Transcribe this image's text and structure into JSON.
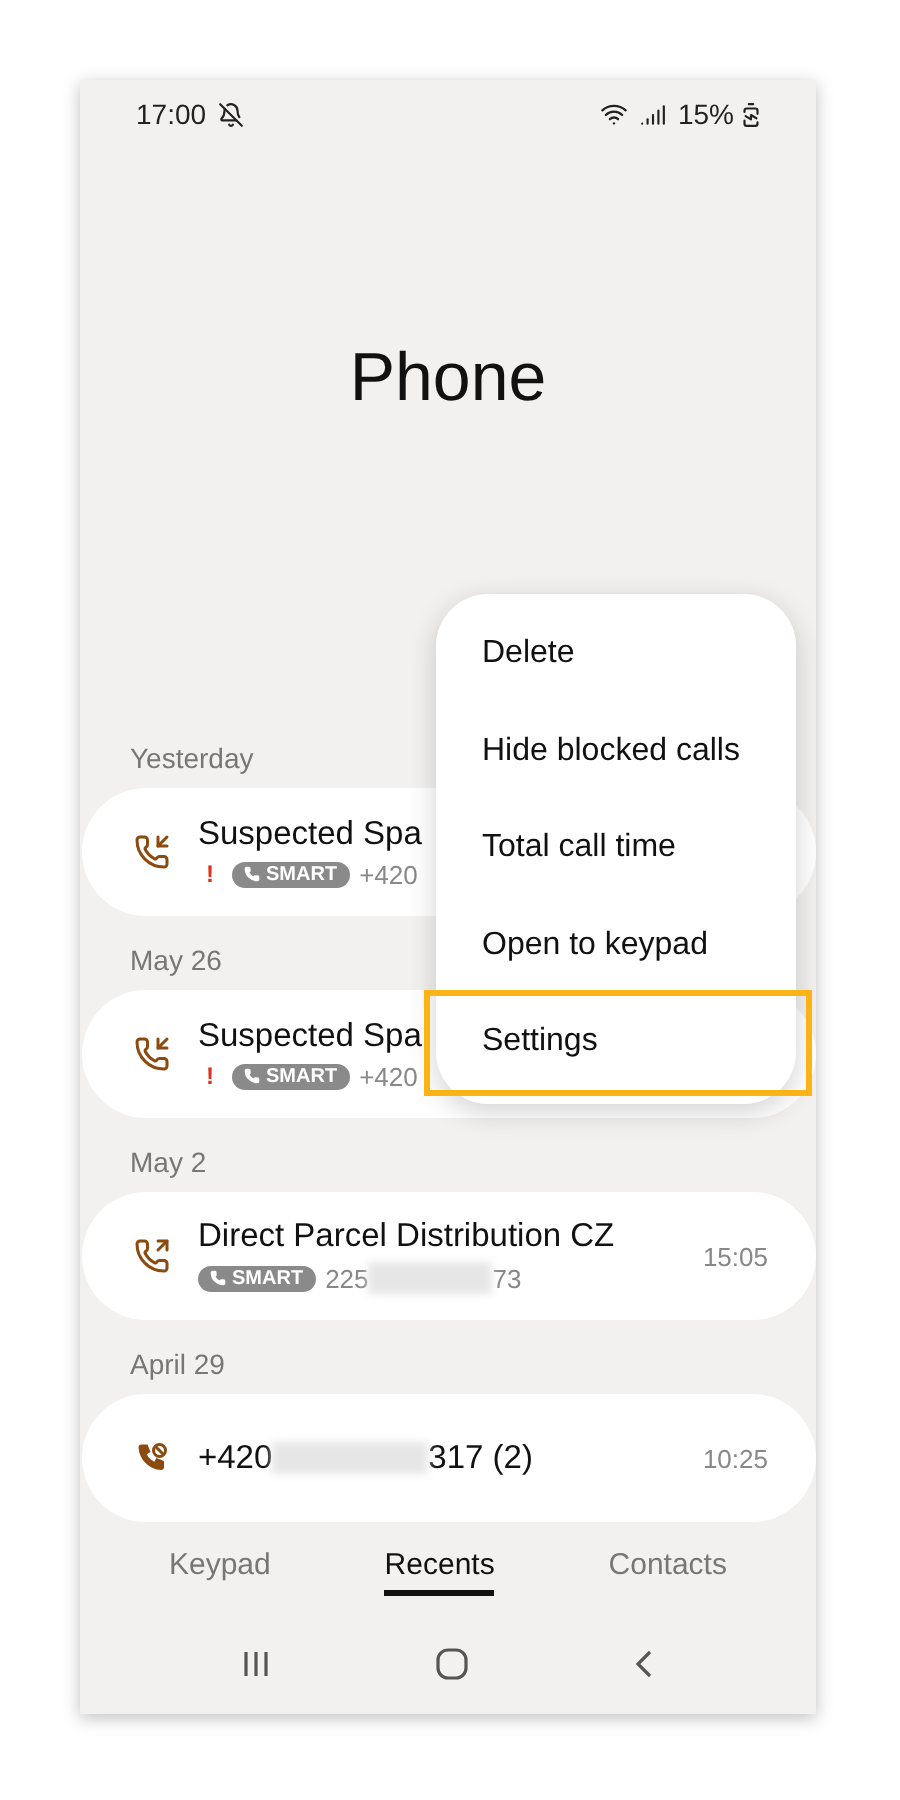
{
  "status_bar": {
    "time": "17:00",
    "battery": "15%"
  },
  "title": "Phone",
  "menu": {
    "items": [
      {
        "label": "Delete",
        "highlighted": false
      },
      {
        "label": "Hide blocked calls",
        "highlighted": false
      },
      {
        "label": "Total call time",
        "highlighted": false
      },
      {
        "label": "Open to keypad",
        "highlighted": false
      },
      {
        "label": "Settings",
        "highlighted": true
      }
    ]
  },
  "groups": [
    {
      "date": "Yesterday",
      "calls": [
        {
          "kind": "incoming",
          "name": "Suspected Spa",
          "spam_mark": "!",
          "badge": "SMART",
          "number": "+420"
        }
      ]
    },
    {
      "date": "May 26",
      "calls": [
        {
          "kind": "incoming",
          "name": "Suspected Spa",
          "spam_mark": "!",
          "badge": "SMART",
          "number": "+420"
        }
      ]
    },
    {
      "date": "May 2",
      "calls": [
        {
          "kind": "outgoing",
          "name": "Direct Parcel Distribution CZ",
          "badge": "SMART",
          "number": "225",
          "number_end": "73",
          "time": "15:05"
        }
      ]
    },
    {
      "date": "April 29",
      "calls": [
        {
          "kind": "blocked",
          "name": "+420",
          "name_end": "317 (2)",
          "time": "10:25"
        }
      ]
    }
  ],
  "tabs": [
    {
      "label": "Keypad",
      "selected": false
    },
    {
      "label": "Recents",
      "selected": true
    },
    {
      "label": "Contacts",
      "selected": false
    }
  ]
}
